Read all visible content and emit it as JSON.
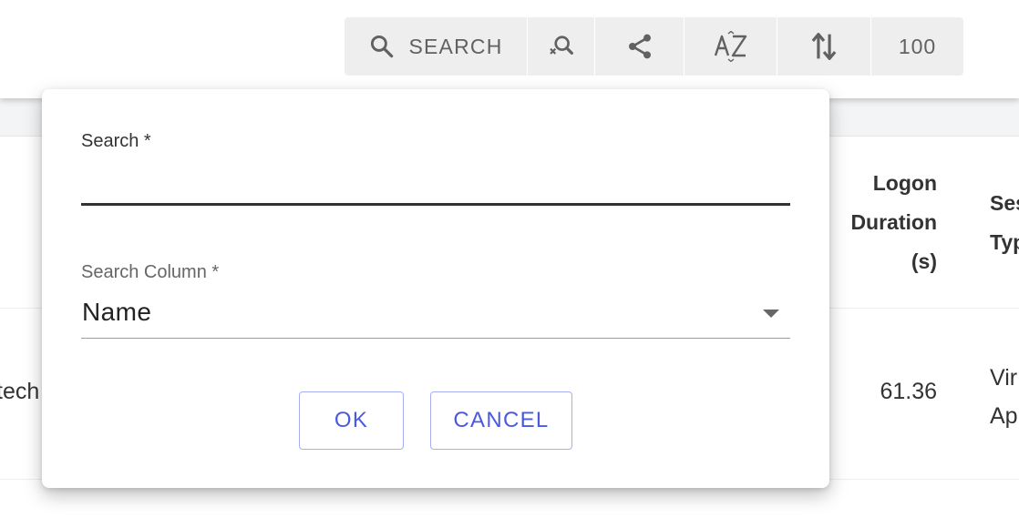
{
  "toolbar": {
    "search_label": "SEARCH",
    "count": "100",
    "icons": [
      "search-icon",
      "search-clear-icon",
      "share-icon",
      "sort-az-icon",
      "sort-icon"
    ]
  },
  "table": {
    "header_logon": [
      "Logon",
      "Duration",
      "(s)"
    ],
    "header_session": [
      "Ses",
      "Typ"
    ],
    "row": {
      "name_fragment": "tech",
      "logon_duration": "61.36",
      "session_type": [
        "Vir",
        "Ap"
      ]
    }
  },
  "dialog": {
    "search_label": "Search *",
    "search_value": "",
    "column_label": "Search Column *",
    "column_value": "Name",
    "ok_label": "OK",
    "cancel_label": "CANCEL"
  },
  "colors": {
    "accent": "#4a5ae0",
    "button_border": "#a7aef2",
    "toolbar_bg": "#eeeeee",
    "icon_grey": "#616161"
  }
}
